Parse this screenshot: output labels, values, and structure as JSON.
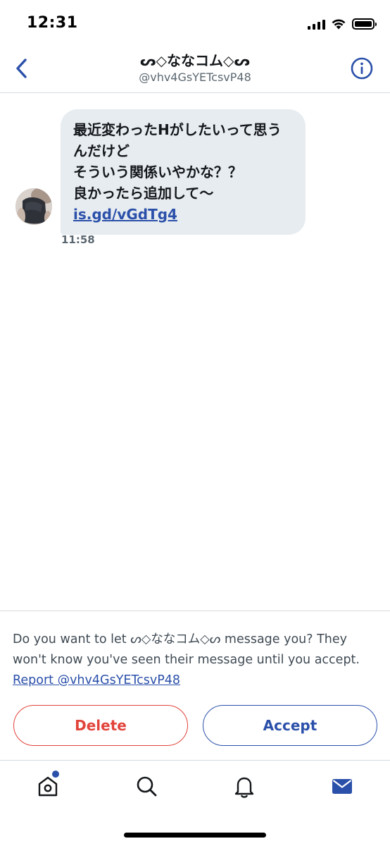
{
  "status_bar": {
    "time": "12:31",
    "battery_level": 1.0
  },
  "header": {
    "back_icon": "chevron-left-icon",
    "name": "ᔕ◇ななコム◇ᔕ",
    "handle": "@vhv4GsYETcsvP48",
    "info_icon": "info-icon"
  },
  "message": {
    "lines": [
      "最近変わったHがしたいって思う",
      "んだけど",
      "そういう関係いやかな？？",
      "良かったら追加して〜"
    ],
    "link": "is.gd/vGdTg4",
    "time": "11:58"
  },
  "request": {
    "prompt_prefix": "Do you want to let ",
    "prompt_name": "ᔕ◇ななコム◇ᔕ",
    "prompt_suffix": " message you? They won't know you've seen their message until you accept.",
    "report_label": "Report @vhv4GsYETcsvP48",
    "delete_label": "Delete",
    "accept_label": "Accept"
  },
  "tabbar": {
    "items": [
      "home-icon",
      "search-icon",
      "bell-icon",
      "mail-icon"
    ]
  },
  "colors": {
    "accent": "#2b50aa",
    "danger": "#e2433a",
    "bubble": "#e7ecf0",
    "muted": "#5b6770"
  }
}
